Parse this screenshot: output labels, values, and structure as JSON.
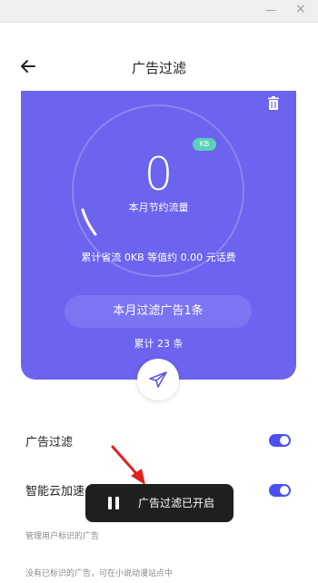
{
  "window": {
    "minimize_glyph": "—",
    "close_glyph": "×"
  },
  "header": {
    "title": "广告过滤",
    "back_icon": "arrow-left-icon"
  },
  "card": {
    "unit_badge": "KB",
    "traffic_value": "0",
    "traffic_caption": "本月节约流量",
    "total_saved_text": "累计省流 0KB 等值约 0.00 元话费",
    "month_filtered_text": "本月过滤广告1条",
    "total_count_text": "累计 23 条",
    "accent_color": "#6c63ee",
    "pill_color": "#7c75f2",
    "badge_color": "#59d1b6"
  },
  "settings": {
    "items": [
      {
        "label": "广告过滤",
        "enabled": true
      },
      {
        "label": "智能云加速",
        "enabled": true
      }
    ],
    "note1": "管理用户标识的广告",
    "note2": "没有已标识的广告，可在小说动漫站点中"
  },
  "toast": {
    "message": "广告过滤已开启"
  },
  "toggle_color": "#4a4ff0"
}
